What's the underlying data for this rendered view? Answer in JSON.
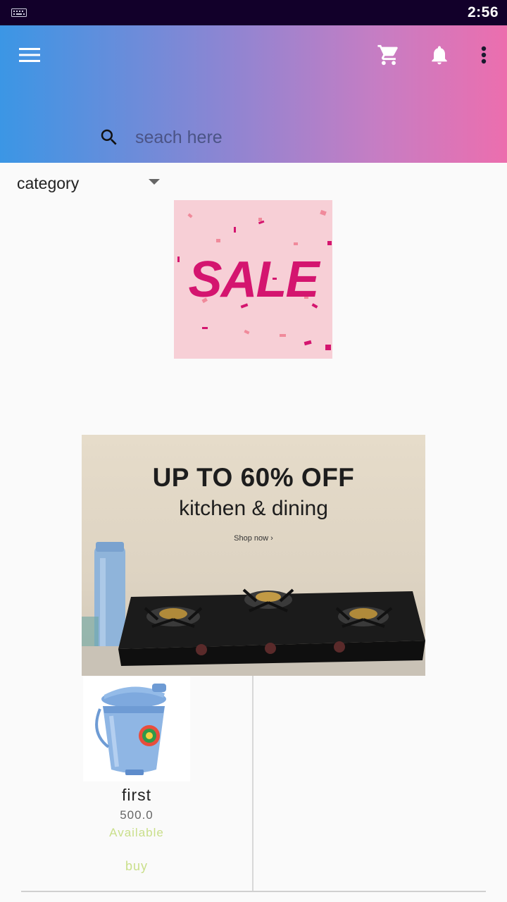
{
  "status_bar": {
    "time": "2:56",
    "icons": [
      "keyboard-icon"
    ],
    "background": "#12002a"
  },
  "app_bar": {
    "gradient": [
      "#3b96e5",
      "#ec6eae"
    ],
    "actions": [
      "menu-icon",
      "cart-icon",
      "bell-icon",
      "more-vert-icon"
    ]
  },
  "search": {
    "placeholder": "seach here",
    "value": ""
  },
  "filter": {
    "category_label": "category"
  },
  "banners": {
    "sale": {
      "text": "SALE",
      "background": "#f7cfd6",
      "accent": "#d4156f"
    },
    "promo": {
      "headline": "UP TO 60% OFF",
      "subheadline": "kitchen & dining",
      "cta": "Shop now ›"
    }
  },
  "products": [
    {
      "name": "first",
      "price": "500.0",
      "status": "Available",
      "buy_label": "buy",
      "status_color": "#c9df8a"
    }
  ]
}
